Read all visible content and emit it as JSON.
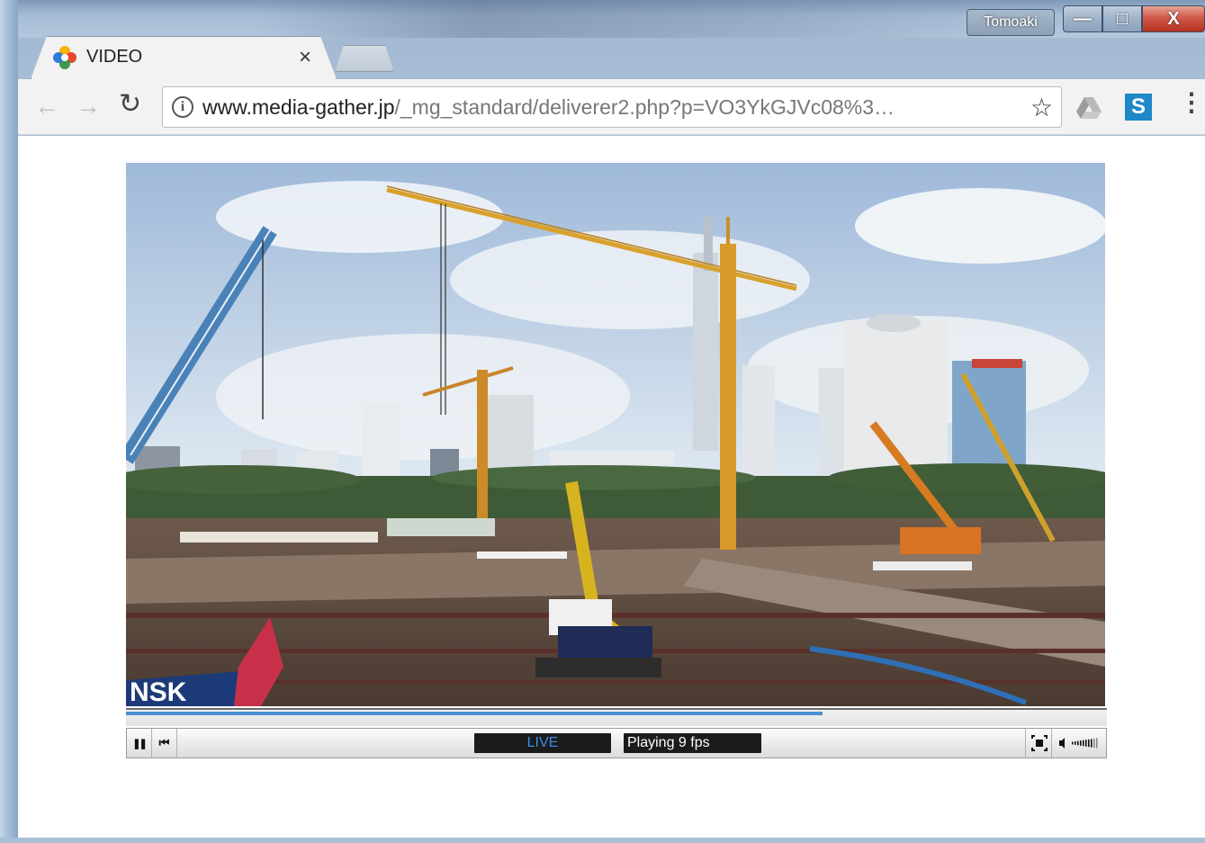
{
  "window": {
    "profile_name": "Tomoaki",
    "min_glyph": "—",
    "max_glyph": "□",
    "close_glyph": "X"
  },
  "tab": {
    "title": "VIDEO",
    "close_glyph": "×",
    "favicon": "media-gather-pinwheel-icon"
  },
  "toolbar": {
    "back_glyph": "←",
    "forward_glyph": "→",
    "reload_glyph": "↻",
    "info_glyph": "i",
    "url_host": "www.media-gather.jp",
    "url_path": "/_mg_standard/deliverer2.php?p=VO3YkGJVc08%3…",
    "star_glyph": "☆",
    "ext_letter": "S",
    "menu_glyph": "⋮"
  },
  "player": {
    "scene": "construction-site-city-skyline",
    "progress": 0.71,
    "pause_glyph": "❚❚",
    "prev_glyph": "⏮",
    "live_label": "LIVE",
    "status_label": "Playing 9 fps",
    "volume_level": 0.8,
    "colors": {
      "live_text": "#3d8be8",
      "progress": "#4f8fd1"
    }
  }
}
